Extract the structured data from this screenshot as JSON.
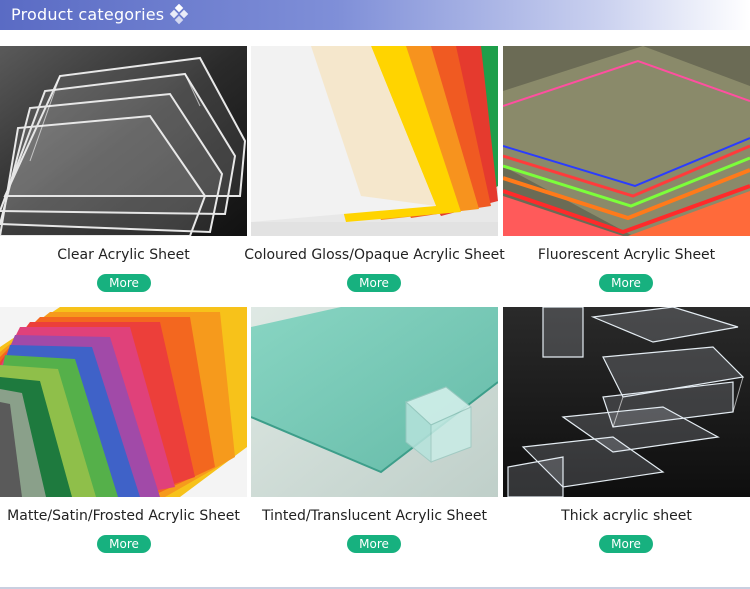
{
  "header": {
    "title": "Product categories"
  },
  "categories": [
    {
      "label": "Clear Acrylic Sheet",
      "more": "More"
    },
    {
      "label": "Coloured Gloss/Opaque Acrylic Sheet",
      "more": "More"
    },
    {
      "label": "Fluorescent Acrylic Sheet",
      "more": "More"
    },
    {
      "label": "Matte/Satin/Frosted Acrylic Sheet",
      "more": "More"
    },
    {
      "label": "Tinted/Translucent Acrylic Sheet",
      "more": "More"
    },
    {
      "label": "Thick acrylic sheet",
      "more": "More"
    }
  ]
}
